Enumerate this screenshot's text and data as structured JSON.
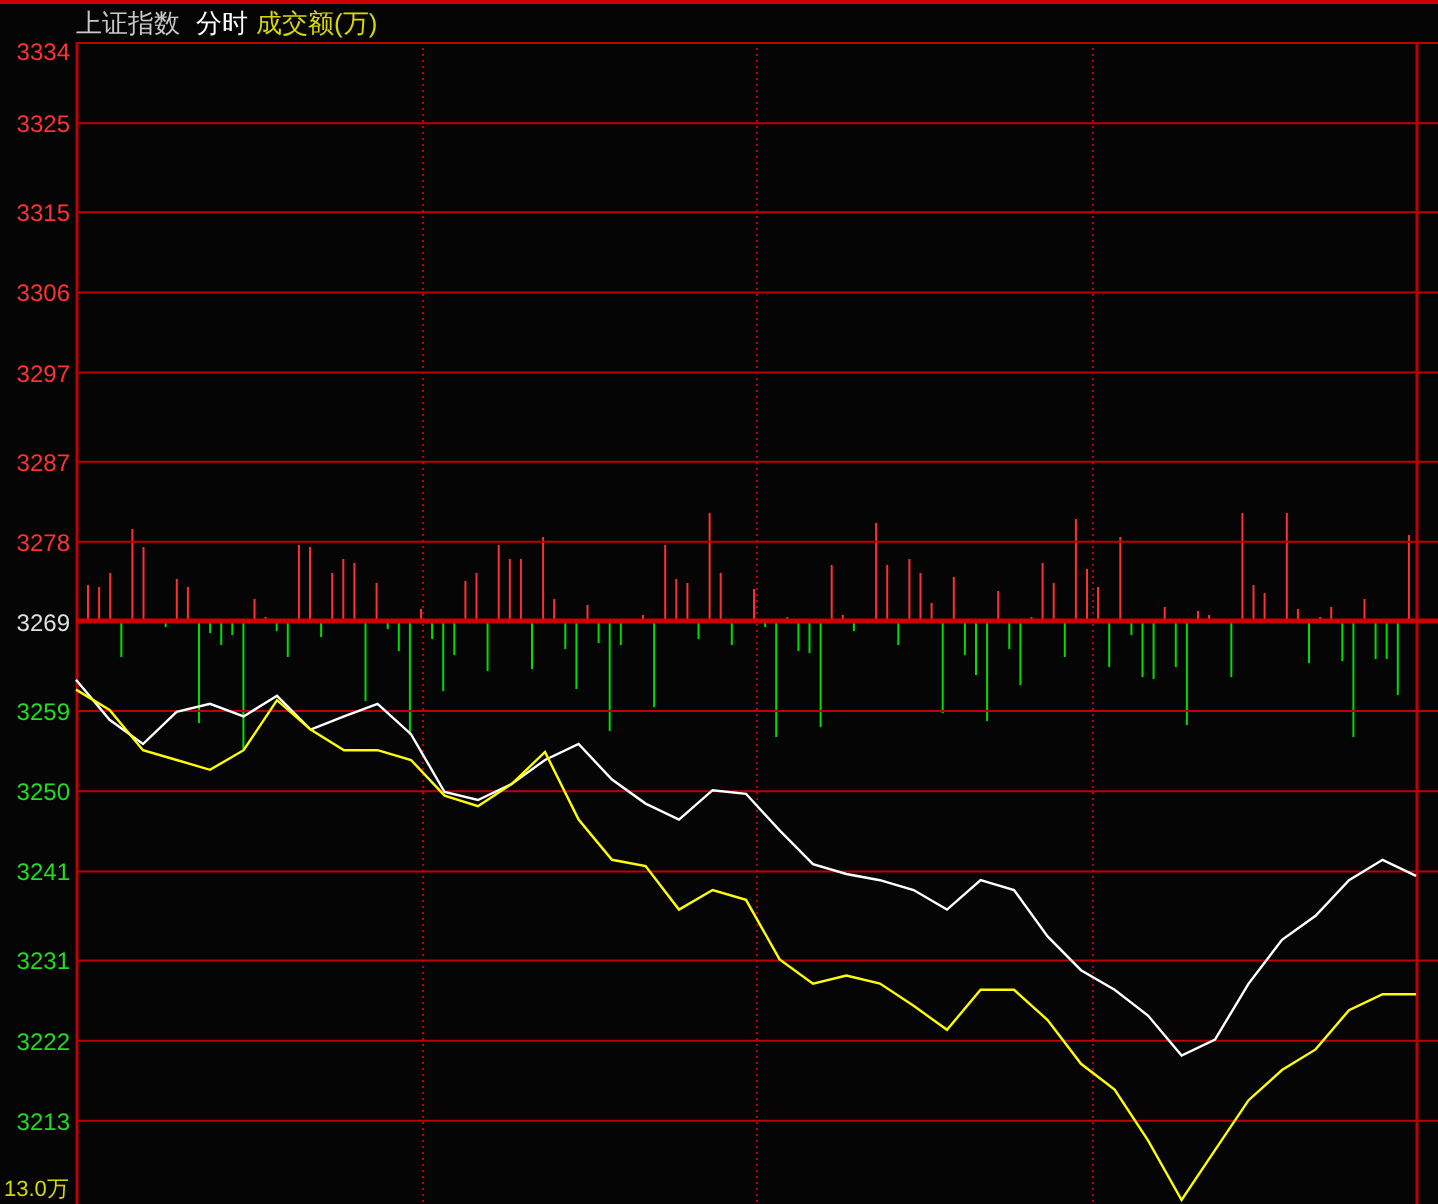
{
  "header": {
    "title": "上证指数",
    "mode": "分时",
    "indicator": "成交额(万)"
  },
  "chart": {
    "chart_data": {
      "type": "line",
      "ylim": [
        3204,
        3334
      ],
      "grid": true,
      "yticks": [
        3334,
        3325,
        3315,
        3306,
        3297,
        3287,
        3278,
        3269,
        3259,
        3250,
        3241,
        3231,
        3222,
        3213
      ],
      "ref_lines": [
        {
          "axis": "y",
          "value": 3269
        }
      ],
      "series": [
        {
          "color": "#ffffff",
          "values": [
            3262.4,
            3257.9,
            3255.2,
            3258.8,
            3259.7,
            3258.3,
            3260.6,
            3256.8,
            3258.3,
            3259.7,
            3256.3,
            3249.8,
            3248.9,
            3250.7,
            3253.4,
            3255.2,
            3251.2,
            3248.5,
            3246.7,
            3250.0,
            3249.6,
            3245.5,
            3241.7,
            3240.6,
            3239.9,
            3238.8,
            3236.6,
            3239.9,
            3238.8,
            3233.6,
            3229.8,
            3227.6,
            3224.7,
            3220.2,
            3222.0,
            3228.3,
            3233.2,
            3235.9,
            3239.9,
            3242.2,
            3240.4
          ]
        },
        {
          "color": "#ffff00",
          "values": [
            3261.3,
            3259.0,
            3254.5,
            3253.4,
            3252.3,
            3254.5,
            3260.1,
            3256.8,
            3254.5,
            3254.5,
            3253.4,
            3249.4,
            3248.2,
            3250.7,
            3254.3,
            3246.7,
            3242.2,
            3241.5,
            3236.6,
            3238.8,
            3237.7,
            3231.0,
            3228.3,
            3229.2,
            3228.3,
            3225.8,
            3223.1,
            3227.6,
            3227.6,
            3224.2,
            3219.3,
            3216.4,
            3210.7,
            3204.0,
            3209.6,
            3215.2,
            3218.6,
            3220.9,
            3225.3,
            3227.1,
            3227.1
          ]
        }
      ]
    },
    "volume_label": "13.0万"
  }
}
